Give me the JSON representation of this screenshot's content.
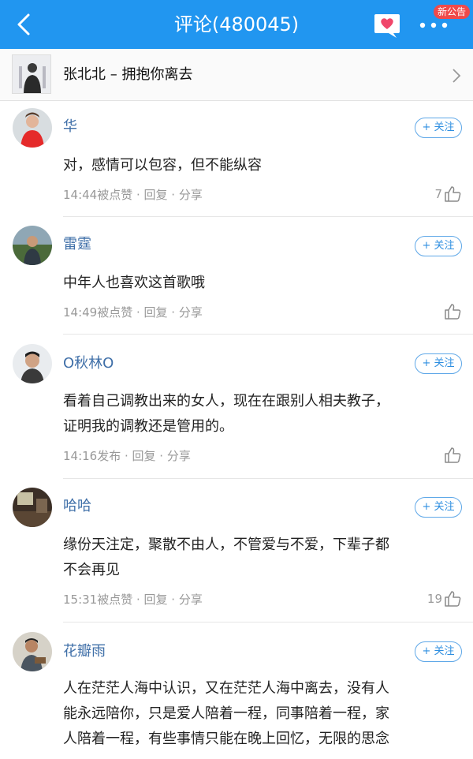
{
  "header": {
    "title": "评论(480045)",
    "badge": "新公告",
    "icons": [
      "back-icon",
      "heart-message-icon",
      "more-icon"
    ]
  },
  "song": {
    "title": "张北北 – 拥抱你离去"
  },
  "comments": [
    {
      "user": "华",
      "follow_label": "+ 关注",
      "text": "对，感情可以包容，但不能纵容",
      "meta": "14:44被点赞   ·   回复   ·   分享",
      "likes": "7"
    },
    {
      "user": "雷霆",
      "follow_label": "+ 关注",
      "text": "中年人也喜欢这首歌哦",
      "meta": "14:49被点赞   ·   回复   ·   分享",
      "likes": ""
    },
    {
      "user": "O秋林O",
      "follow_label": "+ 关注",
      "text": "看着自己调教出来的女人，现在在跟别人相夫教子，\n证明我的调教还是管用的。",
      "meta": "14:16发布   ·   回复   ·   分享",
      "likes": ""
    },
    {
      "user": "哈哈",
      "follow_label": "+ 关注",
      "text": "缘份天注定，聚散不由人，不管爱与不爱，下辈子都\n不会再见",
      "meta": "15:31被点赞   ·   回复   ·   分享",
      "likes": "19"
    },
    {
      "user": "花瓣雨",
      "follow_label": "+ 关注",
      "text": "人在茫茫人海中认识，又在茫茫人海中离去，没有人\n能永远陪你，只是爱人陪着一程，同事陪着一程，家\n人陪着一程，有些事情只能在晚上回忆，无限的思念",
      "meta": "",
      "likes": ""
    }
  ],
  "colors": {
    "header_bg": "#2196f0",
    "username": "#3f6fa8",
    "follow": "#2d8ee0",
    "badge": "#f04a4a"
  }
}
